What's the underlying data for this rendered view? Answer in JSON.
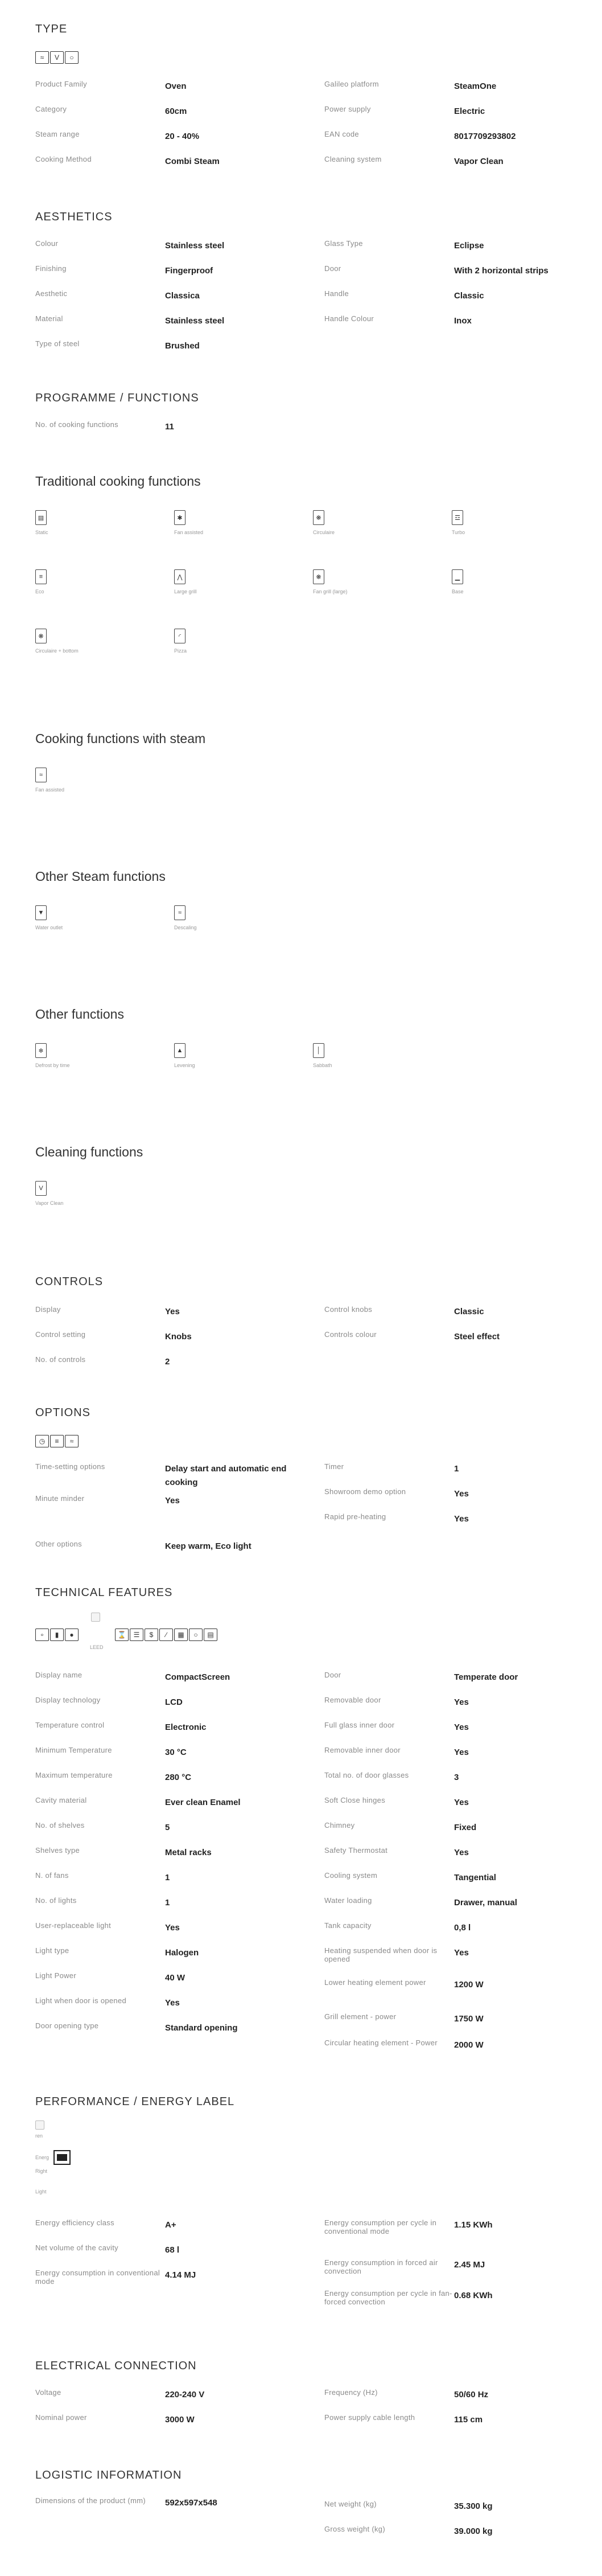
{
  "type": {
    "title": "TYPE",
    "icons": [
      "steam-icon",
      "vapor-clean-icon",
      "eclipse-icon"
    ],
    "rows": [
      {
        "label": "Product Family",
        "value": "Oven"
      },
      {
        "label": "Category",
        "value": "60cm"
      },
      {
        "label": "Steam range",
        "value": "20 - 40%"
      },
      {
        "label": "Cooking Method",
        "value": "Combi Steam"
      },
      {
        "label": "Galileo platform",
        "value": "SteamOne"
      },
      {
        "label": "Power supply",
        "value": "Electric"
      },
      {
        "label": "EAN code",
        "value": "8017709293802"
      },
      {
        "label": "Cleaning system",
        "value": "Vapor Clean"
      }
    ]
  },
  "aesthetics": {
    "title": "AESTHETICS",
    "rows": [
      {
        "label": "Colour",
        "value": "Stainless steel"
      },
      {
        "label": "Finishing",
        "value": "Fingerproof"
      },
      {
        "label": "Aesthetic",
        "value": "Classica"
      },
      {
        "label": "Material",
        "value": "Stainless steel"
      },
      {
        "label": "Type of steel",
        "value": "Brushed"
      },
      {
        "label": "Glass Type",
        "value": "Eclipse"
      },
      {
        "label": "Door",
        "value": "With 2 horizontal strips"
      },
      {
        "label": "Handle",
        "value": "Classic"
      },
      {
        "label": "Handle Colour",
        "value": "Inox"
      }
    ]
  },
  "programme": {
    "title": "PROGRAMME / FUNCTIONS",
    "rows": [
      {
        "label": "No. of cooking functions",
        "value": "11"
      }
    ]
  },
  "traditional": {
    "title": "Traditional cooking functions",
    "items": [
      {
        "icon": "static-icon",
        "label": "Static"
      },
      {
        "icon": "fan-assisted-icon",
        "label": "Fan assisted"
      },
      {
        "icon": "circulaire-icon",
        "label": "Circulaire"
      },
      {
        "icon": "turbo-icon",
        "label": "Turbo"
      },
      {
        "icon": "eco-icon",
        "label": "Eco"
      },
      {
        "icon": "large-grill-icon",
        "label": "Large grill"
      },
      {
        "icon": "fan-grill-large-icon",
        "label": "Fan grill (large)"
      },
      {
        "icon": "base-icon",
        "label": "Base"
      },
      {
        "icon": "circulaire-bottom-icon",
        "label": "Circulaire + bottom"
      },
      {
        "icon": "pizza-icon",
        "label": "Pizza"
      }
    ]
  },
  "steam_fn": {
    "title": "Cooking functions with steam",
    "items": [
      {
        "icon": "fan-assisted-steam-icon",
        "label": "Fan assisted"
      }
    ]
  },
  "other_steam": {
    "title": "Other Steam functions",
    "items": [
      {
        "icon": "water-outlet-icon",
        "label": "Water outlet"
      },
      {
        "icon": "descaling-icon",
        "label": "Descaling"
      }
    ]
  },
  "other_fn": {
    "title": "Other functions",
    "items": [
      {
        "icon": "defrost-by-time-icon",
        "label": "Defrost by time"
      },
      {
        "icon": "levening-icon",
        "label": "Levening"
      },
      {
        "icon": "sabbath-icon",
        "label": "Sabbath"
      }
    ]
  },
  "cleaning": {
    "title": "Cleaning functions",
    "items": [
      {
        "icon": "vapor-clean-icon",
        "label": "Vapor Clean"
      }
    ]
  },
  "controls": {
    "title": "CONTROLS",
    "rows": [
      {
        "label": "Display",
        "value": "Yes"
      },
      {
        "label": "Control setting",
        "value": "Knobs"
      },
      {
        "label": "No. of controls",
        "value": "2"
      },
      {
        "label": "Control knobs",
        "value": "Classic"
      },
      {
        "label": "Controls colour",
        "value": "Steel effect"
      }
    ]
  },
  "options": {
    "title": "OPTIONS",
    "icons": [
      "timer-icon",
      "showroom-icon",
      "rapid-preheat-icon"
    ],
    "rows": [
      {
        "label": "Time-setting options",
        "value": "Delay start and automatic end cooking"
      },
      {
        "label": "Minute minder",
        "value": "Yes"
      },
      {
        "label": "Other options",
        "value": "Keep warm, Eco light"
      },
      {
        "label": "Timer",
        "value": "1"
      },
      {
        "label": "Showroom demo option",
        "value": "Yes"
      },
      {
        "label": "Rapid pre-heating",
        "value": "Yes"
      }
    ]
  },
  "technical": {
    "title": "TECHNICAL FEATURES",
    "icons": [
      "temperature-icon",
      "door-icon",
      "lamp-icon",
      "image-icon",
      "power-icon",
      "shelves-icon",
      "fan-icon",
      "hinges-icon",
      "lcd-icon",
      "cavity-icon",
      "handle-icon"
    ],
    "image_caption": "LEED",
    "rows": [
      {
        "label": "Display name",
        "value": "CompactScreen"
      },
      {
        "label": "Display technology",
        "value": "LCD"
      },
      {
        "label": "Temperature control",
        "value": "Electronic"
      },
      {
        "label": "Minimum Temperature",
        "value": "30 °C"
      },
      {
        "label": "Maximum temperature",
        "value": "280 °C"
      },
      {
        "label": "Cavity material",
        "value": "Ever clean Enamel"
      },
      {
        "label": "No. of shelves",
        "value": "5"
      },
      {
        "label": "Shelves type",
        "value": "Metal racks"
      },
      {
        "label": "N. of fans",
        "value": "1"
      },
      {
        "label": "No. of lights",
        "value": "1"
      },
      {
        "label": "User-replaceable light",
        "value": "Yes"
      },
      {
        "label": "Light type",
        "value": "Halogen"
      },
      {
        "label": "Light Power",
        "value": "40 W"
      },
      {
        "label": "Light when door is opened",
        "value": "Yes"
      },
      {
        "label": "Door opening type",
        "value": "Standard opening"
      },
      {
        "label": "Door",
        "value": "Temperate door"
      },
      {
        "label": "Removable door",
        "value": "Yes"
      },
      {
        "label": "Full glass inner door",
        "value": "Yes"
      },
      {
        "label": "Removable inner door",
        "value": "Yes"
      },
      {
        "label": "Total no. of door glasses",
        "value": "3"
      },
      {
        "label": "Soft Close hinges",
        "value": "Yes"
      },
      {
        "label": "Chimney",
        "value": "Fixed"
      },
      {
        "label": "Safety Thermostat",
        "value": "Yes"
      },
      {
        "label": "Cooling system",
        "value": "Tangential"
      },
      {
        "label": "Water loading",
        "value": "Drawer, manual"
      },
      {
        "label": "Tank capacity",
        "value": "0,8 l"
      },
      {
        "label": "Heating suspended when door is opened",
        "value": "Yes"
      },
      {
        "label": "Lower heating element power",
        "value": "1200 W"
      },
      {
        "label": "Grill element - power",
        "value": "1750 W"
      },
      {
        "label": "Circular heating element - Power",
        "value": "2000 W"
      }
    ]
  },
  "performance": {
    "title": "PERFORMANCE / ENERGY LABEL",
    "img_caption": "ren",
    "energy_label": "Energ",
    "right_label": "Right",
    "light_label": "Light",
    "rows": [
      {
        "label": "Energy efficiency class",
        "value": "A+"
      },
      {
        "label": "Net volume of the cavity",
        "value": "68 l"
      },
      {
        "label": "Energy consumption in conventional mode",
        "value": "4.14 MJ"
      },
      {
        "label": "Energy consumption per cycle in conventional mode",
        "value": "1.15 KWh"
      },
      {
        "label": "Energy consumption in forced air convection",
        "value": "2.45 MJ"
      },
      {
        "label": "Energy consumption per cycle in fan-forced convection",
        "value": "0.68 KWh"
      }
    ]
  },
  "electrical": {
    "title": "ELECTRICAL CONNECTION",
    "rows": [
      {
        "label": "Voltage",
        "value": "220-240 V"
      },
      {
        "label": "Nominal power",
        "value": "3000 W"
      },
      {
        "label": "Frequency (Hz)",
        "value": "50/60 Hz"
      },
      {
        "label": "Power supply cable length",
        "value": "115 cm"
      }
    ]
  },
  "logistic": {
    "title": "LOGISTIC INFORMATION",
    "rows": [
      {
        "label": "Dimensions of the product (mm)",
        "value": "592x597x548"
      },
      {
        "label": "Net weight (kg)",
        "value": "35.300 kg"
      },
      {
        "label": "Gross weight (kg)",
        "value": "39.000 kg"
      }
    ]
  }
}
